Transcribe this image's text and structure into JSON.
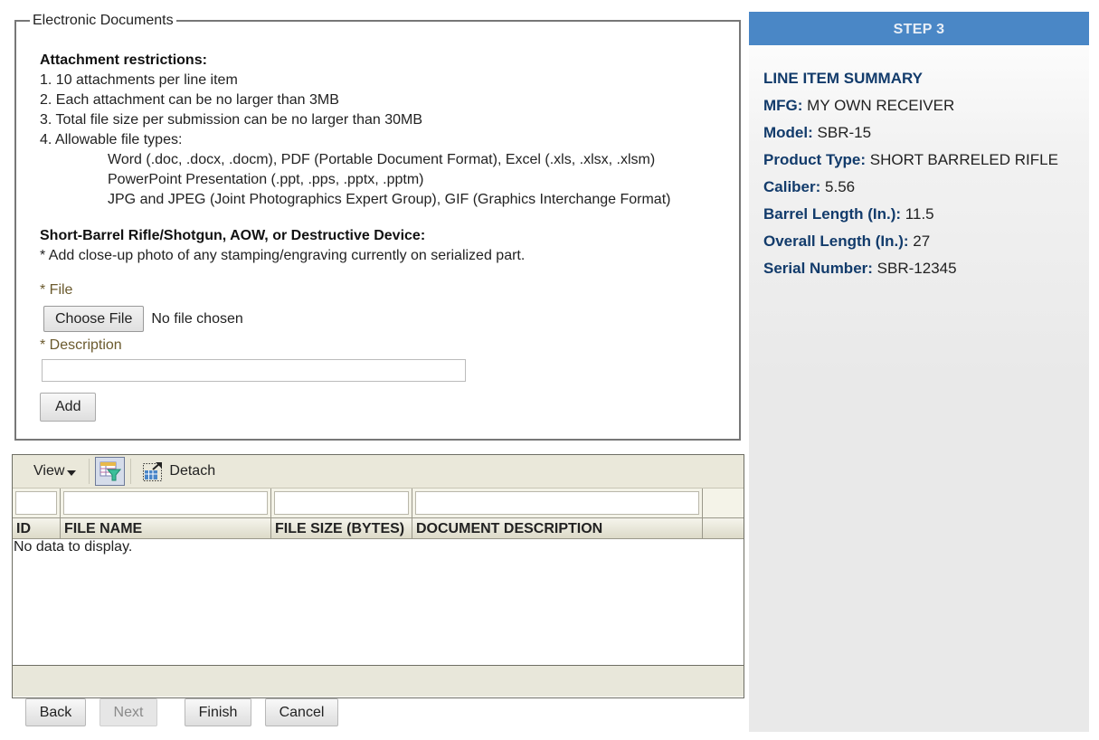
{
  "fieldset": {
    "legend": "Electronic Documents",
    "restrictions_title": "Attachment restrictions:",
    "restrictions": [
      "1. 10 attachments per line item",
      "2. Each attachment can be no larger than 3MB",
      "3. Total file size per submission can be no larger than 30MB",
      "4. Allowable file types:"
    ],
    "file_types": [
      "Word (.doc, .docx, .docm), PDF (Portable Document Format), Excel (.xls, .xlsx, .xlsm)",
      "PowerPoint Presentation (.ppt, .pps, .pptx, .pptm)",
      "JPG and JPEG (Joint Photographics Expert Group), GIF (Graphics Interchange Format)"
    ],
    "sbr_title": "Short-Barrel Rifle/Shotgun, AOW, or Destructive Device:",
    "sbr_note": "* Add close-up photo of any stamping/engraving currently on serialized part.",
    "file_label": "* File",
    "choose_file_label": "Choose File",
    "no_file_text": "No file chosen",
    "description_label": "* Description",
    "description_value": "",
    "add_label": "Add"
  },
  "grid": {
    "toolbar": {
      "view_label": "View",
      "filter_icon": "query-by-example-filter-icon",
      "detach_icon": "detach-table-icon",
      "detach_label": "Detach"
    },
    "filters": [
      "",
      "",
      "",
      ""
    ],
    "columns": [
      "ID",
      "FILE NAME",
      "FILE SIZE (BYTES)",
      "DOCUMENT DESCRIPTION"
    ],
    "rows": [],
    "empty_text": "No data to display."
  },
  "nav": {
    "back": "Back",
    "next": "Next",
    "finish": "Finish",
    "cancel": "Cancel"
  },
  "side": {
    "step": "STEP 3",
    "title": "LINE ITEM SUMMARY",
    "items": [
      {
        "key": "MFG:",
        "value": "MY OWN RECEIVER"
      },
      {
        "key": "Model:",
        "value": "SBR-15"
      },
      {
        "key": "Product Type:",
        "value": "SHORT BARRELED RIFLE"
      },
      {
        "key": "Caliber:",
        "value": "5.56"
      },
      {
        "key": "Barrel Length (In.):",
        "value": "11.5"
      },
      {
        "key": "Overall Length (In.):",
        "value": "27"
      },
      {
        "key": "Serial Number:",
        "value": "SBR-12345"
      }
    ],
    "colors": {
      "header_bg": "#4a87c6",
      "label": "#123b6b"
    }
  }
}
